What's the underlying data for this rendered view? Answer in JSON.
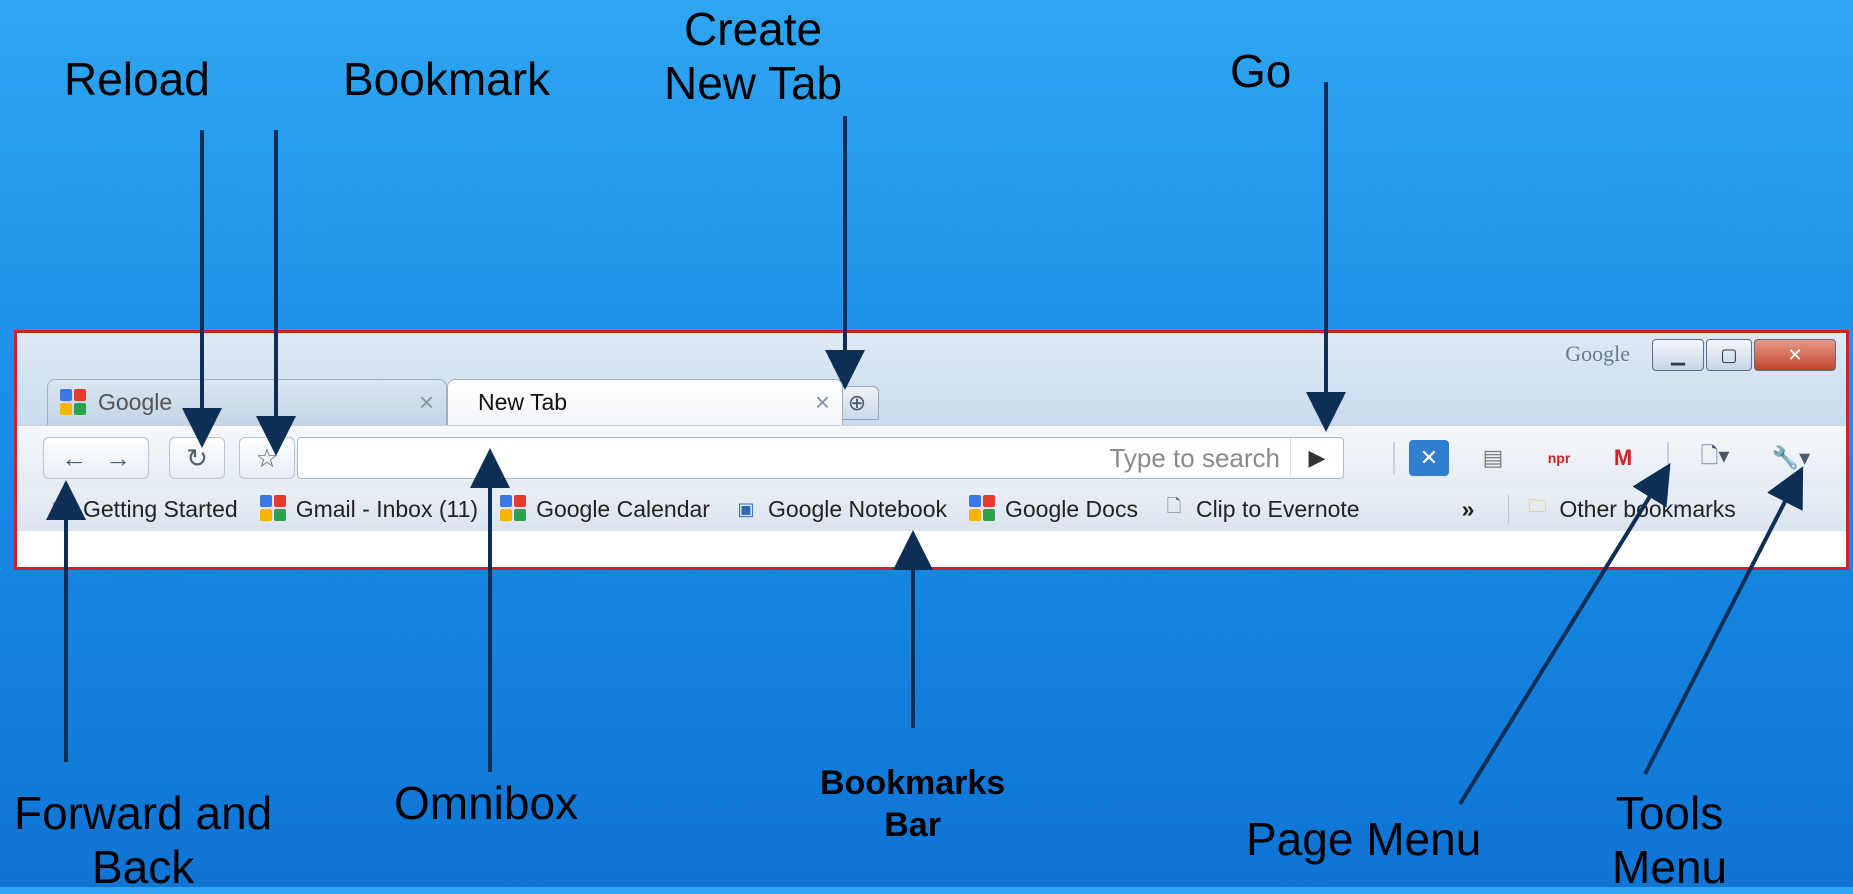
{
  "callouts": {
    "reload": "Reload",
    "bookmark": "Bookmark",
    "create_new_tab_line1": "Create",
    "create_new_tab_line2": "New Tab",
    "go": "Go",
    "forward_back_line1": "Forward and",
    "forward_back_line2": "Back",
    "omnibox": "Omnibox",
    "bookmarks_bar_line1": "Bookmarks",
    "bookmarks_bar_line2": "Bar",
    "page_menu": "Page Menu",
    "tools_menu_line1": "Tools",
    "tools_menu_line2": "Menu"
  },
  "window": {
    "watermark": "Google",
    "minimize_icon": "minimize-icon",
    "maximize_icon": "maximize-icon",
    "close_icon": "close-icon"
  },
  "tabs": [
    {
      "label": "Google",
      "close": "×",
      "active": false
    },
    {
      "label": "New Tab",
      "close": "×",
      "active": true
    }
  ],
  "new_tab_glyph": "⊕",
  "toolbar": {
    "back_glyph": "←",
    "forward_glyph": "→",
    "reload_glyph": "↻",
    "star_glyph": "☆",
    "omnibox_placeholder": "Type to search",
    "omnibox_value": "",
    "go_glyph": "▶",
    "page_menu_glyph": "🗋▾",
    "tools_menu_glyph": "🔧▾"
  },
  "bookmarks": [
    {
      "label": "Getting Started",
      "icon": "ladybug-icon"
    },
    {
      "label": "Gmail - Inbox (11)",
      "icon": "google-icon"
    },
    {
      "label": "Google Calendar",
      "icon": "google-icon"
    },
    {
      "label": "Google Notebook",
      "icon": "notebook-icon"
    },
    {
      "label": "Google Docs",
      "icon": "google-icon"
    },
    {
      "label": "Clip to Evernote",
      "icon": "page-icon"
    }
  ],
  "bookmarks_overflow": "»",
  "other_bookmarks": "Other bookmarks",
  "colors": {
    "highlight_border": "#d0202a",
    "arrow": "#0d2f55"
  }
}
